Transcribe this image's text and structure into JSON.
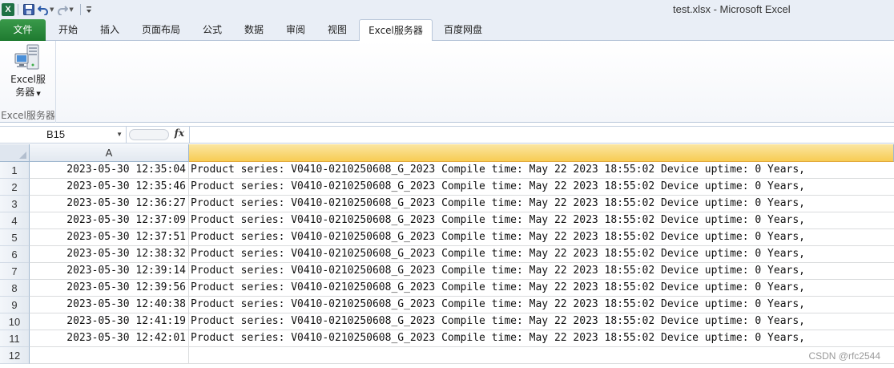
{
  "window": {
    "title": "test.xlsx  -  Microsoft Excel",
    "app_icon": "excel-icon"
  },
  "quick_access": {
    "save": "save-icon",
    "undo": "undo-icon",
    "redo": "redo-icon",
    "customize": "customize-icon"
  },
  "ribbon": {
    "tabs": [
      {
        "label": "文件"
      },
      {
        "label": "开始"
      },
      {
        "label": "插入"
      },
      {
        "label": "页面布局"
      },
      {
        "label": "公式"
      },
      {
        "label": "数据"
      },
      {
        "label": "审阅"
      },
      {
        "label": "视图"
      },
      {
        "label": "Excel服务器"
      },
      {
        "label": "百度网盘"
      }
    ],
    "active_tab": "Excel服务器",
    "group": {
      "button_line1": "Excel服",
      "button_line2": "务器",
      "label": "Excel服务器"
    }
  },
  "formula_bar": {
    "name_box": "B15",
    "fx": "fx",
    "value": ""
  },
  "sheet": {
    "columns": [
      "A",
      ""
    ],
    "rows": [
      {
        "n": "1",
        "a": "2023-05-30 12:35:04",
        "b": "Product series: V0410-0210250608_G_2023 Compile time: May 22 2023 18:55:02 Device uptime: 0 Years,"
      },
      {
        "n": "2",
        "a": "2023-05-30 12:35:46",
        "b": "Product series: V0410-0210250608_G_2023 Compile time: May 22 2023 18:55:02 Device uptime: 0 Years,"
      },
      {
        "n": "3",
        "a": "2023-05-30 12:36:27",
        "b": "Product series: V0410-0210250608_G_2023 Compile time: May 22 2023 18:55:02 Device uptime: 0 Years,"
      },
      {
        "n": "4",
        "a": "2023-05-30 12:37:09",
        "b": "Product series: V0410-0210250608_G_2023 Compile time: May 22 2023 18:55:02 Device uptime: 0 Years,"
      },
      {
        "n": "5",
        "a": "2023-05-30 12:37:51",
        "b": "Product series: V0410-0210250608_G_2023 Compile time: May 22 2023 18:55:02 Device uptime: 0 Years,"
      },
      {
        "n": "6",
        "a": "2023-05-30 12:38:32",
        "b": "Product series: V0410-0210250608_G_2023 Compile time: May 22 2023 18:55:02 Device uptime: 0 Years,"
      },
      {
        "n": "7",
        "a": "2023-05-30 12:39:14",
        "b": "Product series: V0410-0210250608_G_2023 Compile time: May 22 2023 18:55:02 Device uptime: 0 Years,"
      },
      {
        "n": "8",
        "a": "2023-05-30 12:39:56",
        "b": "Product series: V0410-0210250608_G_2023 Compile time: May 22 2023 18:55:02 Device uptime: 0 Years,"
      },
      {
        "n": "9",
        "a": "2023-05-30 12:40:38",
        "b": "Product series: V0410-0210250608_G_2023 Compile time: May 22 2023 18:55:02 Device uptime: 0 Years,"
      },
      {
        "n": "10",
        "a": "2023-05-30 12:41:19",
        "b": "Product series: V0410-0210250608_G_2023 Compile time: May 22 2023 18:55:02 Device uptime: 0 Years,"
      },
      {
        "n": "11",
        "a": "2023-05-30 12:42:01",
        "b": "Product series: V0410-0210250608_G_2023 Compile time: May 22 2023 18:55:02 Device uptime: 0 Years,"
      },
      {
        "n": "12",
        "a": "",
        "b": ""
      }
    ]
  },
  "watermark": "CSDN @rfc2544",
  "colors": {
    "file_tab": "#1f7a30",
    "selected_column_header": "#f7cc54"
  }
}
